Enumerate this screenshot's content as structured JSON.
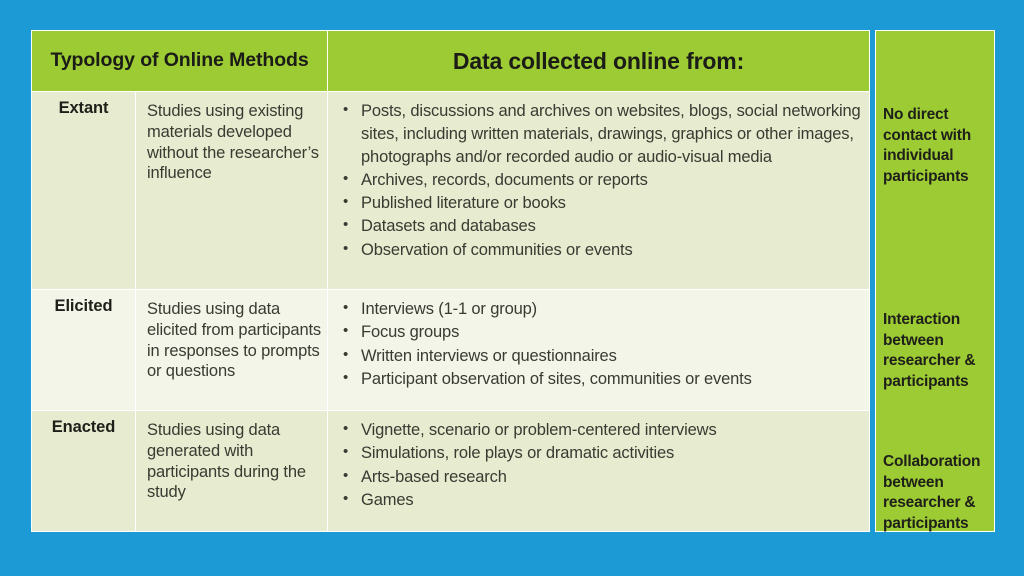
{
  "slide": {
    "background_color": "#1C9AD6",
    "table_header_color": "#9CCB33",
    "row_color_a": "#E7EBCF",
    "row_color_b": "#F2F5E8"
  },
  "header": {
    "left_title": "Typology of Online Methods",
    "center_title": "Data collected online from:",
    "right_title": ""
  },
  "rows": [
    {
      "label": "Extant",
      "description": "Studies using existing materials developed without the researcher’s influence",
      "bullets": [
        "Posts, discussions and archives on websites, blogs, social networking sites, including written materials, drawings, graphics or other images, photographs and/or recorded audio or audio-visual media",
        "Archives, records, documents or reports",
        "Published literature or books",
        "Datasets and databases",
        "Observation of communities or events"
      ],
      "outcome": "No direct contact with individual participants"
    },
    {
      "label": "Elicited",
      "description": "Studies using data elicited from participants in responses to prompts or questions",
      "bullets": [
        "Interviews (1-1 or group)",
        "Focus groups",
        "Written interviews or questionnaires",
        "Participant observation of sites, communities or events"
      ],
      "outcome": "Interaction between researcher & participants"
    },
    {
      "label": "Enacted",
      "description": "Studies using data generated with participants during the study",
      "bullets": [
        "Vignette, scenario or problem-centered interviews",
        "Simulations, role plays or dramatic activities",
        "Arts-based research",
        "Games"
      ],
      "outcome": "Collaboration between researcher & participants"
    }
  ],
  "bullet_glyph": "•"
}
